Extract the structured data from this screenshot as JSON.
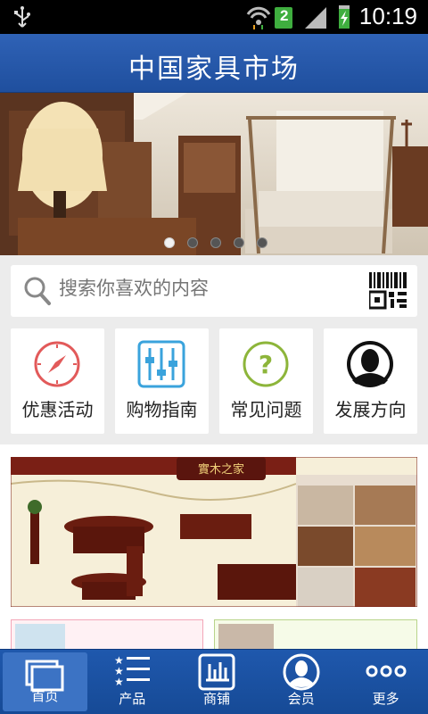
{
  "status": {
    "time": "10:19",
    "sim_badge": "2"
  },
  "appbar": {
    "title": "中国家具市场"
  },
  "banner": {
    "slide_count": 5,
    "active_index": 0
  },
  "search": {
    "placeholder": "搜索你喜欢的内容"
  },
  "tiles": [
    {
      "label": "优惠活动",
      "icon": "compass-icon",
      "color": "#e25a5a"
    },
    {
      "label": "购物指南",
      "icon": "sliders-icon",
      "color": "#3aa3dc"
    },
    {
      "label": "常见问题",
      "icon": "question-icon",
      "color": "#8db53a"
    },
    {
      "label": "发展方向",
      "icon": "person-icon",
      "color": "#111111"
    }
  ],
  "promo": {
    "banner_caption": "實木之家"
  },
  "nav": [
    {
      "label": "首页",
      "icon": "home-icon",
      "active": true
    },
    {
      "label": "产品",
      "icon": "list-icon"
    },
    {
      "label": "商铺",
      "icon": "store-icon"
    },
    {
      "label": "会员",
      "icon": "member-icon"
    },
    {
      "label": "更多",
      "icon": "more-icon"
    }
  ]
}
